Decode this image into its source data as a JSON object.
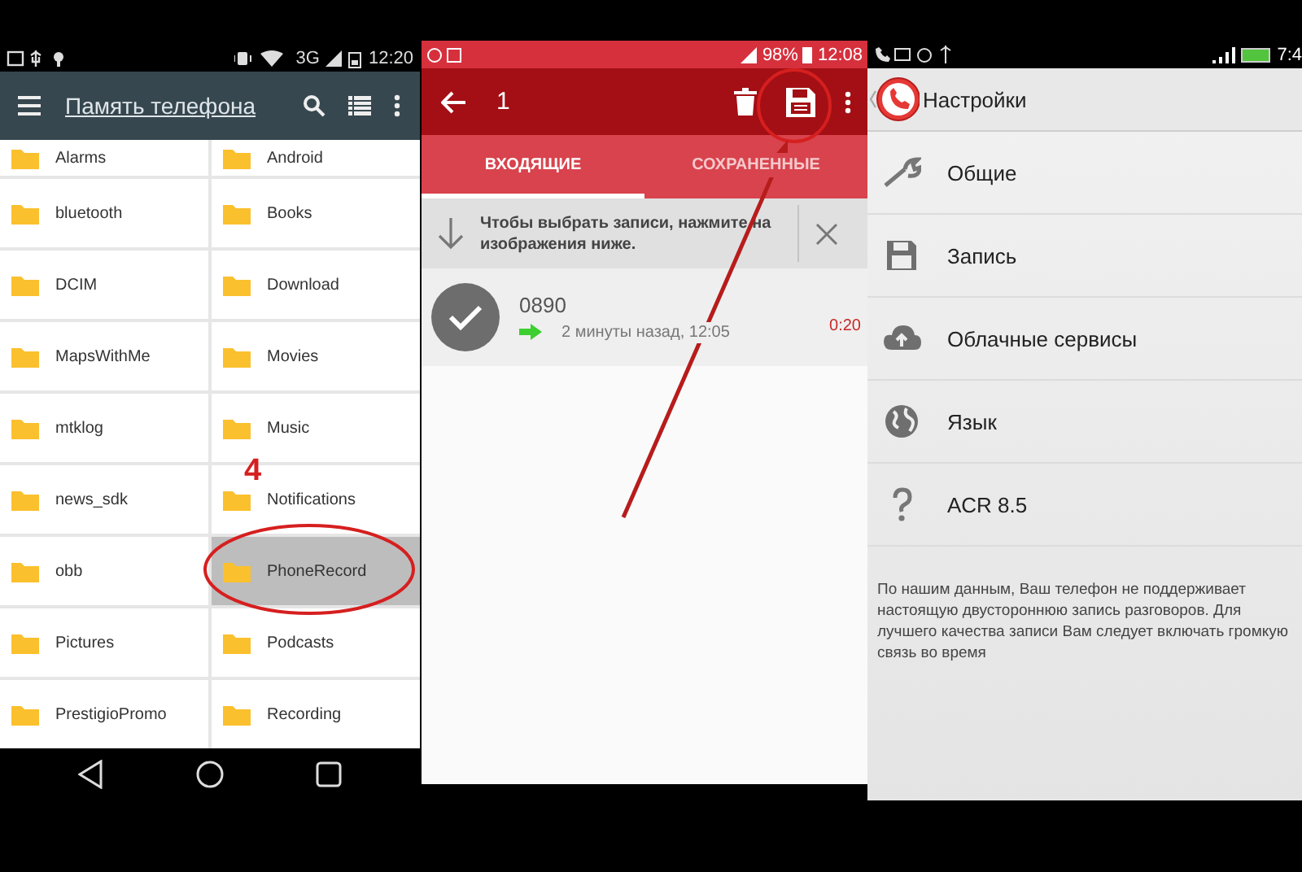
{
  "file_manager": {
    "status_bar": {
      "network": "3G",
      "time": "12:20"
    },
    "toolbar": {
      "title": "Память телефона"
    },
    "folders": [
      {
        "name": "Alarms",
        "selected": false
      },
      {
        "name": "Android",
        "selected": false
      },
      {
        "name": "bluetooth",
        "selected": false
      },
      {
        "name": "Books",
        "selected": false
      },
      {
        "name": "DCIM",
        "selected": false
      },
      {
        "name": "Download",
        "selected": false
      },
      {
        "name": "MapsWithMe",
        "selected": false
      },
      {
        "name": "Movies",
        "selected": false
      },
      {
        "name": "mtklog",
        "selected": false
      },
      {
        "name": "Music",
        "selected": false
      },
      {
        "name": "news_sdk",
        "selected": false
      },
      {
        "name": "Notifications",
        "selected": false
      },
      {
        "name": "obb",
        "selected": false
      },
      {
        "name": "PhoneRecord",
        "selected": true
      },
      {
        "name": "Pictures",
        "selected": false
      },
      {
        "name": "Podcasts",
        "selected": false
      },
      {
        "name": "PrestigioPromo",
        "selected": false
      },
      {
        "name": "Recording",
        "selected": false
      }
    ]
  },
  "recorder": {
    "status_bar": {
      "battery": "98%",
      "time": "12:08"
    },
    "toolbar": {
      "selection_count": "1"
    },
    "tabs": [
      {
        "label": "ВХОДЯЩИЕ",
        "selected": true
      },
      {
        "label": "СОХРАНЕННЫЕ",
        "selected": false
      }
    ],
    "hint": {
      "text": "Чтобы выбрать записи, нажмите на изображения ниже."
    },
    "recordings": [
      {
        "number": "0890",
        "time": "2 минуты назад, 12:05",
        "duration": "0:20",
        "checked": true
      }
    ]
  },
  "settings": {
    "status_bar": {
      "time": "7:4"
    },
    "title": "Настройки",
    "items": [
      {
        "label": "Общие"
      },
      {
        "label": "Запись"
      },
      {
        "label": "Облачные сервисы"
      },
      {
        "label": "Язык"
      },
      {
        "label": "ACR 8.5"
      }
    ],
    "note": "По нашим данным, Ваш телефон не поддерживает настоящую двустороннюю запись разговоров. Для лучшего качества записи Вам следует включать громкую связь во время"
  },
  "annotations": {
    "step_number": "4"
  }
}
